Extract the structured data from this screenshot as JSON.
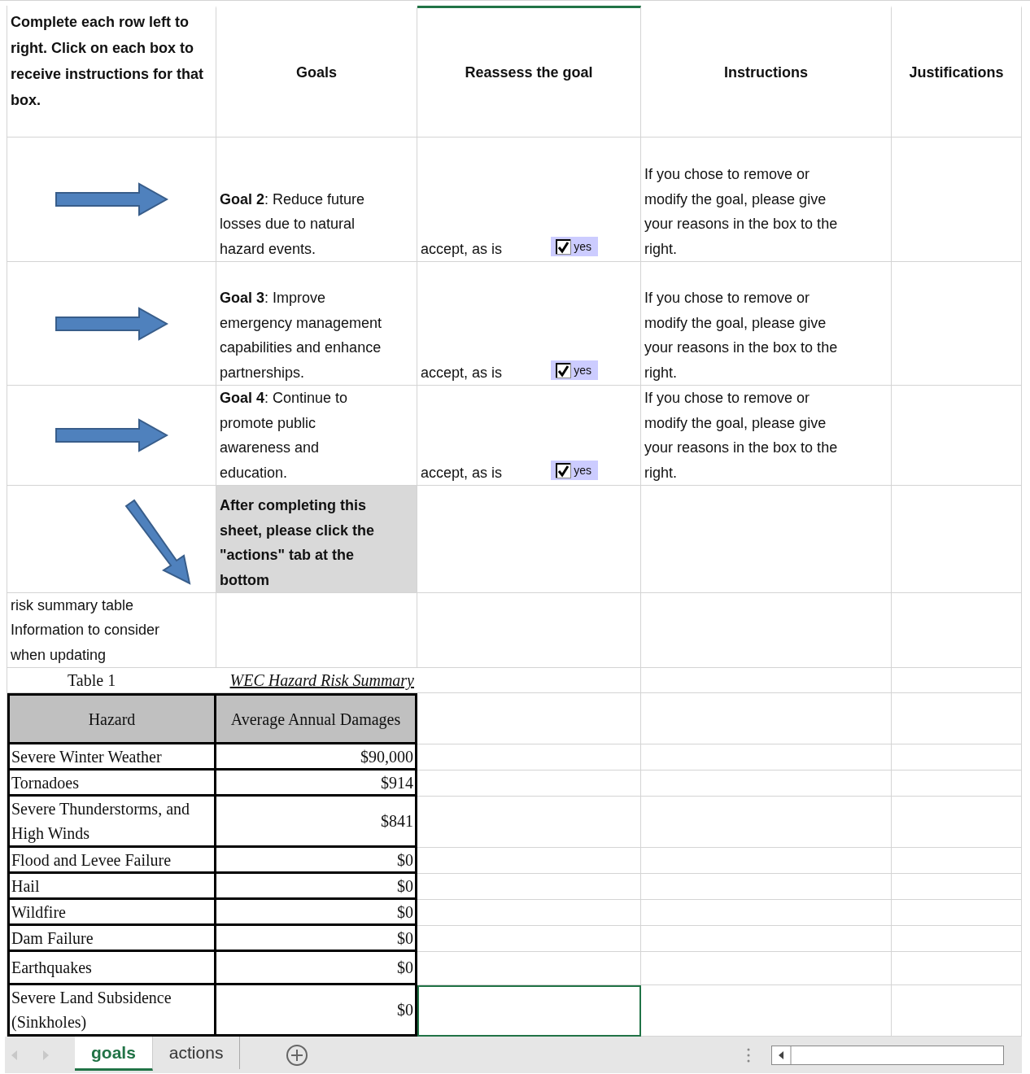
{
  "columns": [
    {
      "label": "Complete each row left to right. Click on each box to receive instructions for that box.",
      "selected": false
    },
    {
      "label": "Goals",
      "selected": false
    },
    {
      "label": "Reassess the goal",
      "selected": true
    },
    {
      "label": "Instructions",
      "selected": false
    },
    {
      "label": "Justifications",
      "selected": false
    }
  ],
  "goals": [
    {
      "goal": "**Goal 2**: Reduce future losses due to natural hazard events.",
      "choice": "accept, as is",
      "checkbox": {
        "label": "yes",
        "checked": true
      },
      "instructions": "If you chose to remove or modify the goal, please give your reasons in the box to the right."
    },
    {
      "goal": "**Goal 3**: Improve emergency management capabilities and enhance partnerships.",
      "choice": "accept, as is",
      "checkbox": {
        "label": "yes",
        "checked": true
      },
      "instructions": "If you chose to remove or modify the goal, please give your reasons in the box to the right."
    },
    {
      "goal": "**Goal 4**: Continue to promote public awareness and education.",
      "choice": "accept, as is",
      "checkbox": {
        "label": "yes",
        "checked": true
      },
      "instructions": "If you chose to remove or modify the goal, please give your reasons in the box to the right."
    }
  ],
  "note": "After completing this sheet, please click the \"actions\" tab at the bottom",
  "risk_label": "risk summary table",
  "risk_hint": "Information to consider when updating",
  "risk_table": {
    "number": "Table 1",
    "title": "WEC Hazard Risk Summary",
    "columns": [
      "Hazard",
      "Average Annual Damages"
    ],
    "rows": [
      {
        "hazard": "Severe Winter Weather",
        "damages": "$90,000"
      },
      {
        "hazard": "Tornadoes",
        "damages": "$914"
      },
      {
        "hazard": "Severe Thunderstorms, and High Winds",
        "damages": "$841"
      },
      {
        "hazard": "Flood and Levee Failure",
        "damages": "$0"
      },
      {
        "hazard": "Hail",
        "damages": "$0"
      },
      {
        "hazard": "Wildfire",
        "damages": "$0"
      },
      {
        "hazard": "Dam Failure",
        "damages": "$0"
      },
      {
        "hazard": "Earthquakes",
        "damages": "$0"
      },
      {
        "hazard": "Severe Land Subsidence (Sinkholes)",
        "damages": "$0"
      }
    ]
  },
  "sheet_tabs": [
    {
      "label": "goals",
      "selected": true
    },
    {
      "label": "actions",
      "selected": false
    }
  ]
}
